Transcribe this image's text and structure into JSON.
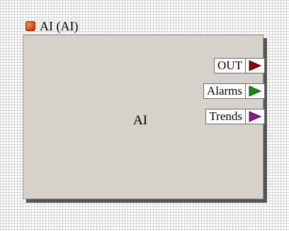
{
  "block": {
    "title": "AI (AI)",
    "label": "AI",
    "status_color": "#d84a1a",
    "body_color": "#d6d2cb"
  },
  "ports": [
    {
      "label": "OUT",
      "icon": "arrow-right-icon",
      "color": "#8b0a0a"
    },
    {
      "label": "Alarms",
      "icon": "arrow-right-icon",
      "color": "#1a8a1a"
    },
    {
      "label": "Trends",
      "icon": "arrow-right-icon",
      "color": "#8a1a8a"
    }
  ]
}
